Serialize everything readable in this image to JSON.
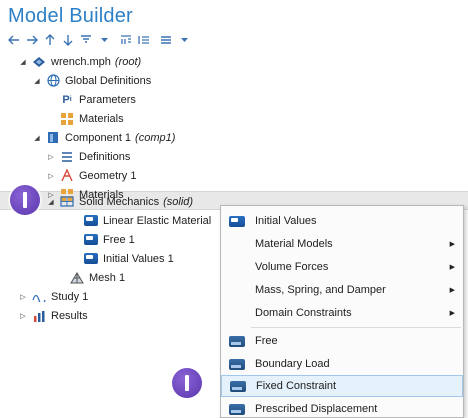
{
  "title": "Model Builder",
  "toolbar": {
    "icons": [
      "arrow-left-icon",
      "arrow-right-icon",
      "arrow-up-icon",
      "arrow-down-icon",
      "filter-icon",
      "dropdown-icon",
      "expand-icon",
      "collapse-icon",
      "list-icon",
      "dropdown-icon"
    ]
  },
  "tree": {
    "root": {
      "label": "wrench.mph",
      "tag": "(root)"
    },
    "global": {
      "label": "Global Definitions"
    },
    "parameters": {
      "label": "Parameters"
    },
    "materials_g": {
      "label": "Materials"
    },
    "component": {
      "label": "Component 1",
      "tag": "(comp1)"
    },
    "definitions": {
      "label": "Definitions"
    },
    "geometry": {
      "label": "Geometry 1"
    },
    "materials_c": {
      "label": "Materials"
    },
    "solid": {
      "label": "Solid Mechanics",
      "tag": "(solid)"
    },
    "linear": {
      "label": "Linear Elastic Material"
    },
    "free": {
      "label": "Free 1"
    },
    "initial": {
      "label": "Initial Values 1"
    },
    "mesh": {
      "label": "Mesh 1"
    },
    "study": {
      "label": "Study 1"
    },
    "results": {
      "label": "Results"
    }
  },
  "menu": {
    "items": [
      {
        "label": "Initial Values",
        "icon": "physics-node-icon",
        "submenu": false
      },
      {
        "label": "Material Models",
        "submenu": true
      },
      {
        "label": "Volume Forces",
        "submenu": true
      },
      {
        "label": "Mass, Spring, and Damper",
        "submenu": true
      },
      {
        "label": "Domain Constraints",
        "submenu": true
      },
      {
        "label": "Free",
        "icon": "boundary-node-icon",
        "submenu": false
      },
      {
        "label": "Boundary Load",
        "icon": "boundary-node-icon",
        "submenu": false
      },
      {
        "label": "Fixed Constraint",
        "icon": "boundary-node-icon",
        "submenu": false,
        "highlighted": true
      },
      {
        "label": "Prescribed Displacement",
        "icon": "boundary-node-icon",
        "submenu": false
      }
    ]
  },
  "colors": {
    "title": "#2e80c6",
    "highlight": "#e5f1fb",
    "callout": "#6a45bf"
  }
}
